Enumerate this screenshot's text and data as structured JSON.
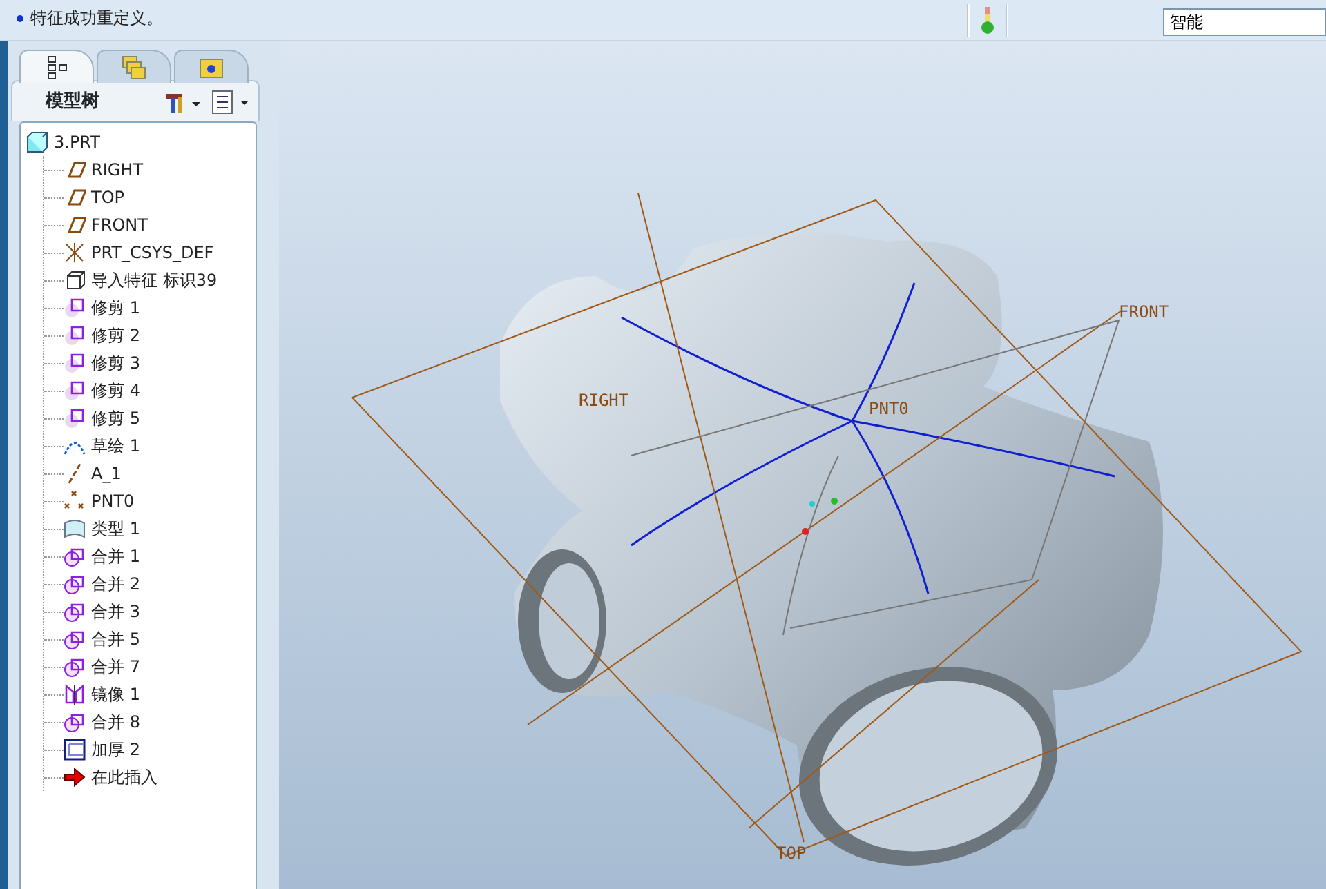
{
  "messages": [
    {
      "text": "特征成功重定义。"
    }
  ],
  "status": {
    "filter": "智能"
  },
  "panel_tabs": [
    {
      "kind": "tree",
      "selected": true
    },
    {
      "kind": "layers",
      "selected": false
    },
    {
      "kind": "favorites",
      "selected": false
    }
  ],
  "model_tree": {
    "title": "模型树",
    "root": {
      "label": "3.PRT",
      "children": [
        {
          "label": "RIGHT",
          "kind": "plane"
        },
        {
          "label": "TOP",
          "kind": "plane"
        },
        {
          "label": "FRONT",
          "kind": "plane"
        },
        {
          "label": "PRT_CSYS_DEF",
          "kind": "csys"
        },
        {
          "label": "导入特征 标识39",
          "kind": "import"
        },
        {
          "label": "修剪 1",
          "kind": "trim"
        },
        {
          "label": "修剪 2",
          "kind": "trim"
        },
        {
          "label": "修剪 3",
          "kind": "trim"
        },
        {
          "label": "修剪 4",
          "kind": "trim"
        },
        {
          "label": "修剪 5",
          "kind": "trim"
        },
        {
          "label": "草绘 1",
          "kind": "sketch"
        },
        {
          "label": "A_1",
          "kind": "axis"
        },
        {
          "label": "PNT0",
          "kind": "point"
        },
        {
          "label": "类型 1",
          "kind": "style"
        },
        {
          "label": "合并 1",
          "kind": "merge"
        },
        {
          "label": "合并 2",
          "kind": "merge"
        },
        {
          "label": "合并 3",
          "kind": "merge"
        },
        {
          "label": "合并 5",
          "kind": "merge"
        },
        {
          "label": "合并 7",
          "kind": "merge"
        },
        {
          "label": "镜像 1",
          "kind": "mirror"
        },
        {
          "label": "合并 8",
          "kind": "merge"
        },
        {
          "label": "加厚 2",
          "kind": "thicken"
        },
        {
          "label": "在此插入",
          "kind": "insert"
        }
      ]
    }
  },
  "viewport": {
    "datum_labels": [
      {
        "text": "RIGHT",
        "kind": "right"
      },
      {
        "text": "FRONT",
        "kind": "front"
      },
      {
        "text": "PNT0",
        "kind": "point"
      },
      {
        "text": "TOP",
        "kind": "top"
      }
    ]
  }
}
